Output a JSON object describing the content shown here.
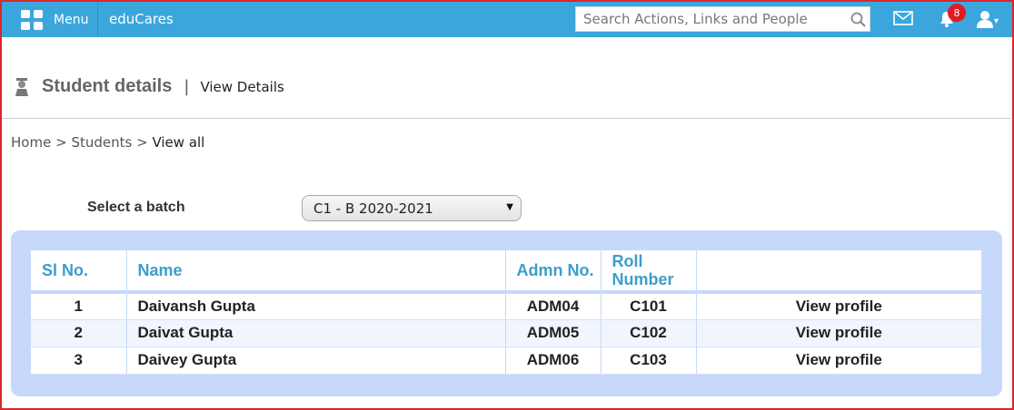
{
  "topbar": {
    "menu_label": "Menu",
    "app_name": "eduCares",
    "search_placeholder": "Search Actions, Links and People",
    "notification_count": "8",
    "color": "#3ba6dc"
  },
  "header": {
    "title": "Student details",
    "separator": "|",
    "subtitle": "View Details"
  },
  "breadcrumb": {
    "items": [
      "Home",
      "Students",
      "View all"
    ],
    "sep": ">"
  },
  "batch": {
    "label": "Select a batch",
    "selected": "C1 - B 2020-2021"
  },
  "table": {
    "columns": [
      "Sl No.",
      "Name",
      "Admn No.",
      "Roll Number",
      ""
    ],
    "rows": [
      {
        "sl": "1",
        "name": "Daivansh Gupta",
        "admn": "ADM04",
        "roll": "C101",
        "action": "View profile"
      },
      {
        "sl": "2",
        "name": "Daivat Gupta",
        "admn": "ADM05",
        "roll": "C102",
        "action": "View profile"
      },
      {
        "sl": "3",
        "name": "Daivey Gupta",
        "admn": "ADM06",
        "roll": "C103",
        "action": "View profile"
      }
    ]
  }
}
